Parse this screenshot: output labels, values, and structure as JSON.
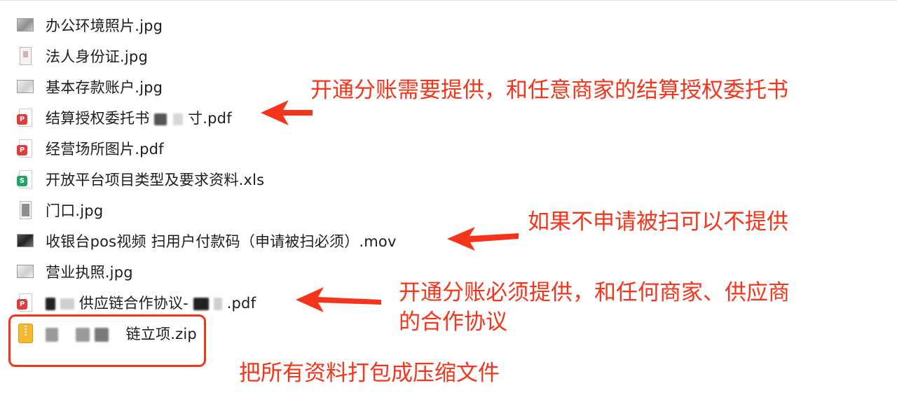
{
  "files": [
    {
      "name": "办公环境照片.jpg",
      "icon": "image-thumbnail-icon"
    },
    {
      "name": "法人身份证.jpg",
      "icon": "id-card-thumbnail-icon"
    },
    {
      "name": "基本存款账户.jpg",
      "icon": "image-thumbnail-icon"
    },
    {
      "name_prefix": "结算授权委托书",
      "name_suffix": "寸.pdf",
      "icon": "pdf-icon"
    },
    {
      "name": "经营场所图片.pdf",
      "icon": "pdf-icon"
    },
    {
      "name": "开放平台项目类型及要求资料.xls",
      "icon": "spreadsheet-icon"
    },
    {
      "name": "门口.jpg",
      "icon": "image-thumbnail-icon"
    },
    {
      "name": "收银台pos视频 扫用户付款码（申请被扫必须）.mov",
      "icon": "video-thumbnail-icon"
    },
    {
      "name": "营业执照.jpg",
      "icon": "image-thumbnail-icon"
    },
    {
      "name_prefix": "供应链合作协议-",
      "name_suffix": ".pdf",
      "icon": "pdf-icon"
    },
    {
      "name_suffix": "链立项.zip",
      "icon": "zip-archive-icon"
    }
  ],
  "annotations": {
    "settlement": "开通分账需要提供，和任意商家的结算授权委托书",
    "scan": "如果不申请被扫可以不提供",
    "coop_line1": "开通分账必须提供，和任何商家、供应商",
    "coop_line2": "的合作协议",
    "zip": "把所有资料打包成压缩文件"
  },
  "colors": {
    "annotation": "#f5341a",
    "text": "#1d1d1d",
    "pdf_badge": "#e03c3c",
    "xls_badge": "#21a366",
    "zip": "#f5b82e"
  }
}
